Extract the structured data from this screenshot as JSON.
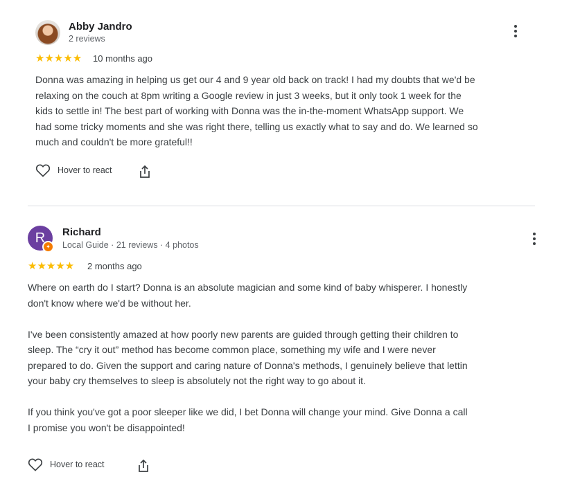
{
  "reviews": [
    {
      "name": "Abby Jandro",
      "meta": "2 reviews",
      "stars": "★★★★★",
      "date": "10 months ago",
      "text": "Donna was amazing in helping us get our 4 and 9 year old back on track! I had my doubts that we'd be\nrelaxing on the couch at 8pm writing a Google review in just 3 weeks, but it only took 1 week for the\nkids to settle in! The best part of working with Donna was the in-the-moment WhatsApp support. We\nhad some tricky moments and she was right there, telling us exactly what to say and do. We learned so\nmuch and couldn't be more grateful!!",
      "react_label": "Hover to react"
    },
    {
      "name": "Richard",
      "avatar_letter": "R",
      "meta": "Local Guide · 21 reviews · 4 photos",
      "stars": "★★★★★",
      "date": "2 months ago",
      "text": "Where on earth do I start? Donna is an absolute magician and some kind of baby whisperer. I honestly\ndon't know where we'd be without her.\n\nI've been consistently amazed at how poorly new parents are guided through getting their children to\nsleep. The “cry it out” method has become common place, something my wife and I were never\nprepared to do. Given the support and caring nature of Donna's methods, I genuinely believe that lettin\nyour baby cry themselves to sleep is absolutely not the right way to go about it.\n\nIf you think you've got a poor sleeper like we did, I bet Donna will change your mind. Give Donna a call\nI promise you won't be disappointed!",
      "react_label": "Hover to react"
    }
  ],
  "colors": {
    "star": "#fbbc04",
    "avatar_richard": "#6b3fa0",
    "guide_badge": "#f57c00"
  },
  "icons": [
    "heart-icon",
    "share-icon",
    "more-vert-icon",
    "local-guide-badge-icon"
  ]
}
